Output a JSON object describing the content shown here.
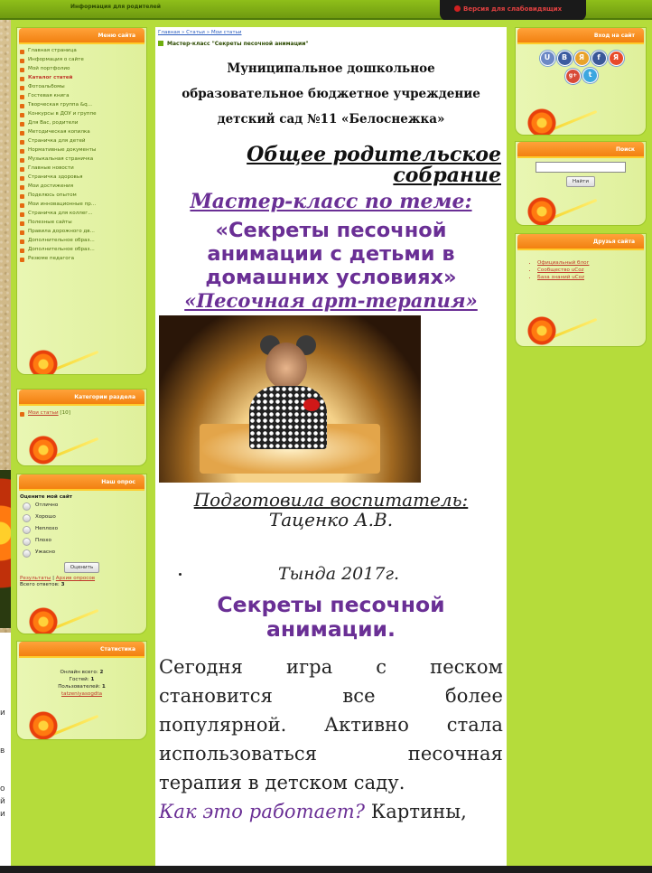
{
  "topbar": {
    "parents_link": "Информация для родителей",
    "vision_label": "Версия для слабовидящих"
  },
  "left": {
    "menu_title": "Меню сайта",
    "menu_items": [
      "Главная страница",
      "Информация о сайте",
      "Мой портфолио",
      "Каталог статей",
      "Фотоальбомы",
      "Гостевая книга",
      "Творческая группа &q...",
      "Конкурсы в ДОУ и группе",
      "Для Вас, родители",
      "Методическая копилка",
      "Страничка для детей",
      "Нормативные документы",
      "Музыкальная страничка",
      "Главные новости",
      "Страничка здоровья",
      "Мои достижения",
      "Поделюсь опытом",
      "Мои инновационные пр...",
      "Страничка для коллег...",
      "Полезные сайты",
      "Правила дорожного дв...",
      "Дополнительное образ...",
      "Дополнительное образ...",
      "Резюме педагога"
    ],
    "active_item": "Каталог статей",
    "categories_title": "Категории раздела",
    "category": "Мои статьи",
    "category_count": "[10]",
    "poll_title": "Наш опрос",
    "poll_question": "Оцените мой сайт",
    "poll_options": [
      "Отлично",
      "Хорошо",
      "Неплохо",
      "Плохо",
      "Ужасно"
    ],
    "poll_button": "Оценить",
    "poll_results": "Результаты",
    "poll_sep": " | ",
    "poll_archive": "Архив опросов",
    "poll_total_label": "Всего ответов: ",
    "poll_total": "3",
    "stats_title": "Статистика",
    "stats_online": "Онлайн всего: ",
    "stats_online_n": "2",
    "stats_guests": "Гостей: ",
    "stats_guests_n": "1",
    "stats_users": "Пользователей: ",
    "stats_users_n": "1",
    "stats_user": "tatzeniyasogdta"
  },
  "right": {
    "login_title": "Вход на сайт",
    "social": [
      {
        "t": "U",
        "c": "#6d89c5"
      },
      {
        "t": "B",
        "c": "#3b5ba0"
      },
      {
        "t": "Я",
        "c": "#e8a22a"
      },
      {
        "t": "f",
        "c": "#3b5998"
      },
      {
        "t": "Я",
        "c": "#e84a2a"
      },
      {
        "t": "g+",
        "c": "#d84a38"
      },
      {
        "t": "t",
        "c": "#3da7e0"
      }
    ],
    "search_title": "Поиск",
    "search_button": "Найти",
    "friends_title": "Друзья сайта",
    "friends": [
      "Официальный блог",
      "Сообщество uCoz",
      "База знаний uCoz"
    ]
  },
  "content": {
    "breadcrumbs": "Главная » Статьи » Мои статьи",
    "page_title": "Мастер-класс \"Секреты песочной анимации\"",
    "org_line1": "Муниципальное дошкольное",
    "org_line2": "образовательное бюджетное учреждение",
    "org_line3": "детский сад №11 «Белоснежка»",
    "h_general_1": "Общее родительское",
    "h_general_2": "собрание",
    "h_master": "Мастер-класс по теме:",
    "h_secrets_1": "«Секреты песочной",
    "h_secrets_2": "анимации с детьми в",
    "h_secrets_3": "домашних условиях»",
    "h_art": "«Песочная арт-терапия»",
    "prepared": "Подготовила воспитатель:",
    "author": "Таценко А.В.",
    "year": "Тында 2017г.",
    "h_anim_1": "Секреты песочной",
    "h_anim_2": "анимации.",
    "para_1": "Сегодня игра с песком становится все более популярной. Активно стала использоваться песочная терапия в детском саду.",
    "para_q": "Как это работает?",
    "para_2": " Картины,"
  },
  "left_edge": {
    "fragments": [
      "и",
      "в",
      "о",
      "й",
      "и"
    ]
  }
}
